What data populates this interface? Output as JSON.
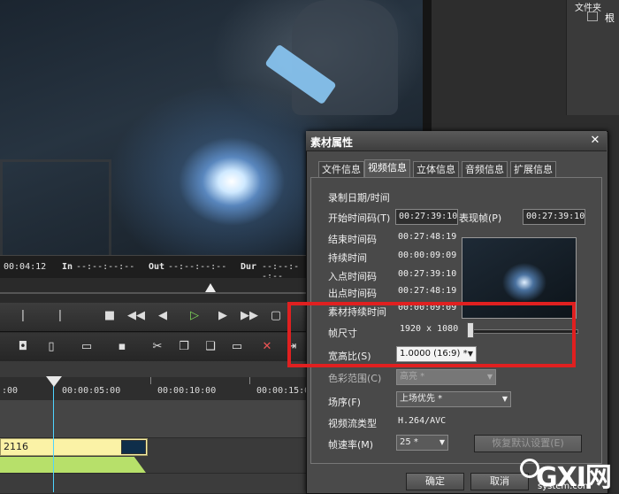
{
  "timecode_bar": {
    "current": "00:04:12",
    "in_label": "In",
    "in_value": "--:--:--:--",
    "out_label": "Out",
    "out_value": "--:--:--:--",
    "dur_label": "Dur",
    "dur_value": "--:--:--:--"
  },
  "ruler": {
    "t0": ":00",
    "t1": "00:00:05:00",
    "t2": "00:00:10:00",
    "t3": "00:00:15:0"
  },
  "clip": {
    "label": "2116"
  },
  "bin": {
    "title": "文件夹",
    "root": "根"
  },
  "dialog": {
    "title": "素材属性",
    "tabs": [
      "文件信息",
      "视频信息",
      "立体信息",
      "音频信息",
      "扩展信息"
    ],
    "active_tab": "视频信息",
    "record_datetime_label": "录制日期/时间",
    "start_tc_label": "开始时间码(T)",
    "start_tc_value": "00:27:39:10",
    "poster_frame_label": "表现帧(P)",
    "poster_frame_value": "00:27:39:10",
    "end_tc_label": "结束时间码",
    "end_tc_value": "00:27:48:19",
    "duration_label": "持续时间",
    "duration_value": "00:00:09:09",
    "in_point_label": "入点时间码",
    "in_point_value": "00:27:39:10",
    "out_point_label": "出点时间码",
    "out_point_value": "00:27:48:19",
    "clip_duration_label": "素材持续时间",
    "clip_duration_value": "00:00:09:09",
    "frame_size_label": "帧尺寸",
    "frame_size_value": "1920 x 1080",
    "aspect_label": "宽高比(S)",
    "aspect_value": "1.0000 (16:9) *",
    "color_range_label": "色彩范围(C)",
    "color_range_value": "高亮 *",
    "field_order_label": "场序(F)",
    "field_order_value": "上场优先 *",
    "stream_type_label": "视频流类型",
    "stream_type_value": "H.264/AVC",
    "frame_rate_label": "帧速率(M)",
    "frame_rate_value": "25 *",
    "restore_button": "恢复默认设置(E)",
    "ok_button": "确定",
    "cancel_button": "取消"
  },
  "watermark": {
    "text": "GXI网",
    "sub": "system.com"
  },
  "colors": {
    "highlight": "#e02020",
    "clip_video": "#fbf2a6",
    "clip_audio": "#b7e06a",
    "playhead": "#4fd4ff"
  }
}
